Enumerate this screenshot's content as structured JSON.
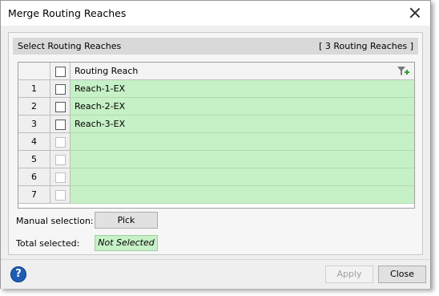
{
  "window": {
    "title": "Merge Routing Reaches"
  },
  "panel": {
    "title": "Select Routing Reaches",
    "count": "[ 3 Routing Reaches ]"
  },
  "grid": {
    "column_header": "Routing Reach",
    "rows": [
      {
        "num": "1",
        "value": "Reach-1-EX"
      },
      {
        "num": "2",
        "value": "Reach-2-EX"
      },
      {
        "num": "3",
        "value": "Reach-3-EX"
      },
      {
        "num": "4",
        "value": ""
      },
      {
        "num": "5",
        "value": ""
      },
      {
        "num": "6",
        "value": ""
      },
      {
        "num": "7",
        "value": ""
      }
    ]
  },
  "manual_selection": {
    "label": "Manual selection:",
    "button": "Pick"
  },
  "total_selected": {
    "label": "Total selected:",
    "value": "Not Selected"
  },
  "footer": {
    "help": "?",
    "apply": "Apply",
    "close": "Close"
  },
  "colors": {
    "row_fill": "#c6f0c6",
    "help_blue": "#1f5db5"
  }
}
